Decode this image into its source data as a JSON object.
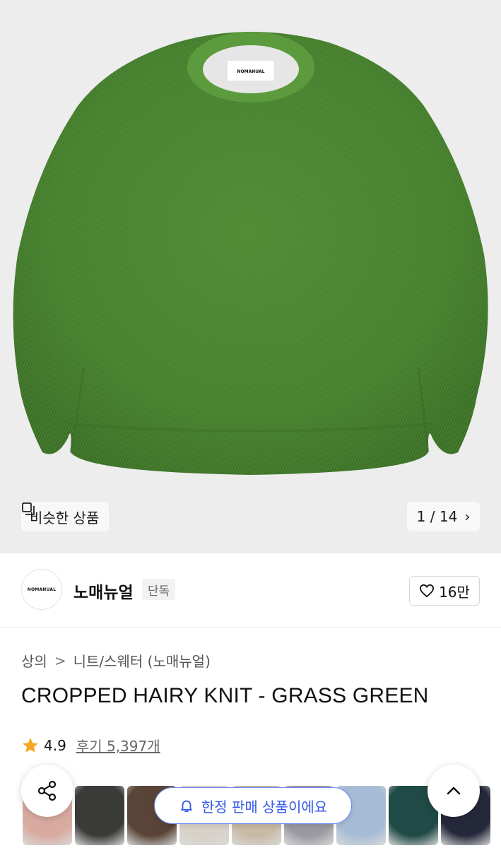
{
  "product_image": {
    "label_text": "NOMANUAL",
    "similar_chip": {
      "label": "비슷한 상품",
      "icon": "similar-items-icon"
    },
    "counter": {
      "text": "1 / 14",
      "icon": "chevron-right-icon"
    }
  },
  "brand": {
    "logo_text": "NOMANUAL",
    "name": "노매뉴얼",
    "tag": "단독",
    "likes": "16만",
    "like_icon": "heart-outline-icon"
  },
  "breadcrumb": {
    "items": [
      "상의",
      "니트/스웨터 (노매뉴얼)"
    ],
    "separator": ">"
  },
  "product": {
    "title": "CROPPED HAIRY KNIT - GRASS GREEN"
  },
  "rating": {
    "score": "4.9",
    "reviews": "후기 5,397개",
    "star_color": "#f5a623"
  },
  "color_swatches": {
    "colors": [
      "#d9aaa0",
      "#3a3b38",
      "#5a4438",
      "#d8d1c8",
      "#c7b9a3",
      "#9a98a0",
      "#a6bcd6",
      "#1f4a45",
      "#25283a"
    ]
  },
  "floating": {
    "share_icon": "share-icon",
    "limited_label": "한정 판매 상품이에요",
    "limited_icon": "bell-icon",
    "top_icon": "chevron-up-icon"
  },
  "colors": {
    "accent_blue": "#3558e8",
    "sweater_green": "#4f8a35"
  }
}
